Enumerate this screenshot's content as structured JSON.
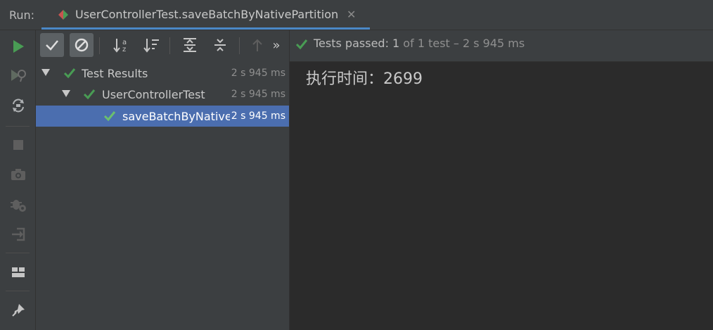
{
  "header": {
    "run_label": "Run:",
    "tab_title": "UserControllerTest.saveBatchByNativePartition",
    "close_glyph": "✕"
  },
  "left_toolbar": {
    "items": [
      "rerun-icon",
      "rerun-failed-icon",
      "toggle-auto-test-icon",
      "stop-icon",
      "camera-icon",
      "debug-settings-icon",
      "exit-icon",
      "layout-icon",
      "pin-icon"
    ]
  },
  "tree_toolbar": {
    "items": [
      "show-passed-icon",
      "show-ignored-icon",
      "sort-alpha-icon",
      "sort-duration-icon",
      "expand-all-icon",
      "collapse-all-icon",
      "previous-failed-icon",
      "more-icon"
    ],
    "more_glyph": "»"
  },
  "tree": {
    "rows": [
      {
        "label": "Test Results",
        "time": "2 s 945 ms"
      },
      {
        "label": "UserControllerTest",
        "time": "2 s 945 ms"
      },
      {
        "label": "saveBatchByNativePartition",
        "time": "2 s 945 ms"
      }
    ]
  },
  "status": {
    "passed_label": "Tests passed: 1",
    "passed_detail": " of 1 test – 2 s 945 ms"
  },
  "console": {
    "lines": [
      "执行时间：2699"
    ]
  },
  "colors": {
    "accent": "#4a88c7",
    "pass_green": "#499c54",
    "selection": "#4b6eaf",
    "run_green": "#499c54"
  }
}
